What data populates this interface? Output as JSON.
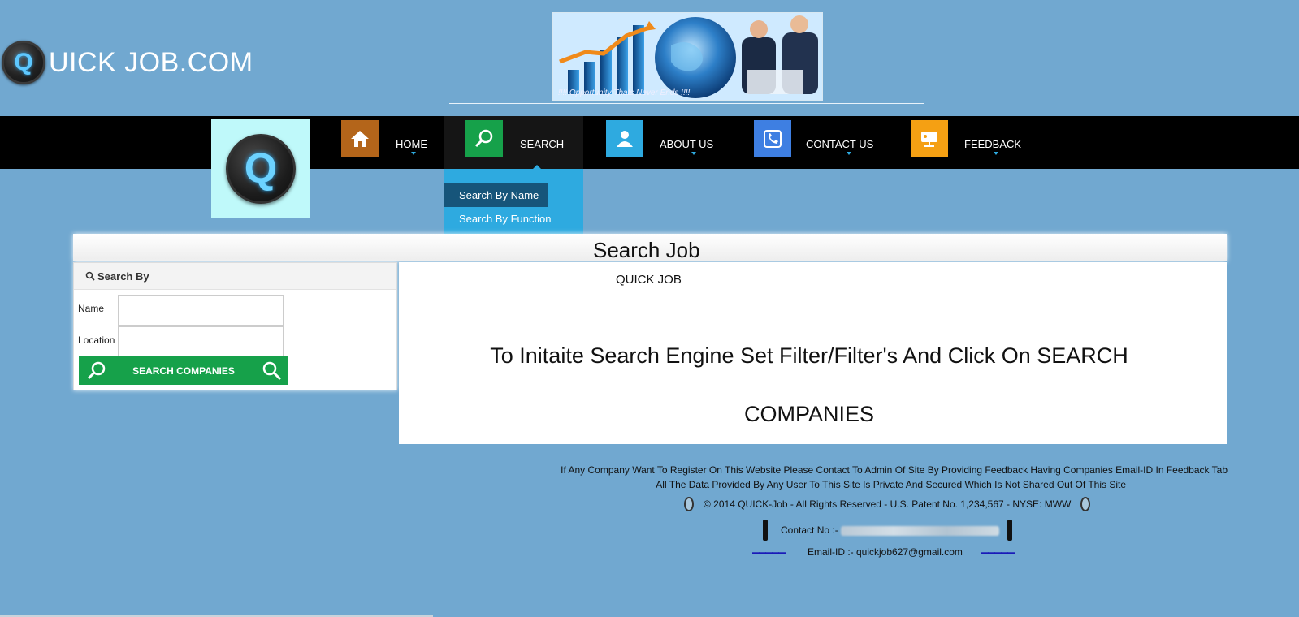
{
  "site": {
    "logo_letter": "Q",
    "title": "UICK JOB.COM"
  },
  "banner": {
    "caption": "!!!! Opportunity Thats Never Ends !!!!"
  },
  "nav": {
    "logo_letter": "Q",
    "items": [
      {
        "label": "HOME",
        "icon": "home-icon",
        "color": "#b4651a"
      },
      {
        "label": "SEARCH",
        "icon": "search-icon",
        "color": "#16a14a",
        "active": true
      },
      {
        "label": "ABOUT US",
        "icon": "user-icon",
        "color": "#2eaae0"
      },
      {
        "label": "CONTACT US",
        "icon": "phone-icon",
        "color": "#3e7fe2"
      },
      {
        "label": "FEEDBACK",
        "icon": "chat-icon",
        "color": "#f5a013"
      }
    ],
    "dropdown": [
      "Search By Name",
      "Search By Function"
    ]
  },
  "page": {
    "title": "Search Job",
    "subtitle": "QUICK JOB",
    "instruction_line1": "To Initaite Search Engine Set Filter/Filter's And Click On SEARCH",
    "instruction_line2": "COMPANIES"
  },
  "search_form": {
    "heading": "Search By",
    "name_label": "Name",
    "name_value": "",
    "location_label": "Location",
    "location_value": "",
    "button_label": "SEARCH COMPANIES"
  },
  "footer": {
    "line1": "If Any Company Want To Register On This Website Please Contact To Admin Of Site By Providing Feedback Having Companies Email-ID In Feedback Tab",
    "line2": "All The Data Provided By Any User To This Site Is Private And Secured Which Is Not Shared Out Of This Site",
    "copyright": "© 2014 QUICK-Job - All Rights Reserved - U.S. Patent No. 1,234,567 - NYSE: MWW",
    "contact_label": "Contact No :-",
    "email": "Email-ID :- quickjob627@gmail.com"
  },
  "colors": {
    "background": "#71a8d0",
    "navbar": "#000000",
    "dropdown": "#2eaae0",
    "dropdown_active": "#16557a",
    "button": "#16a14a"
  }
}
